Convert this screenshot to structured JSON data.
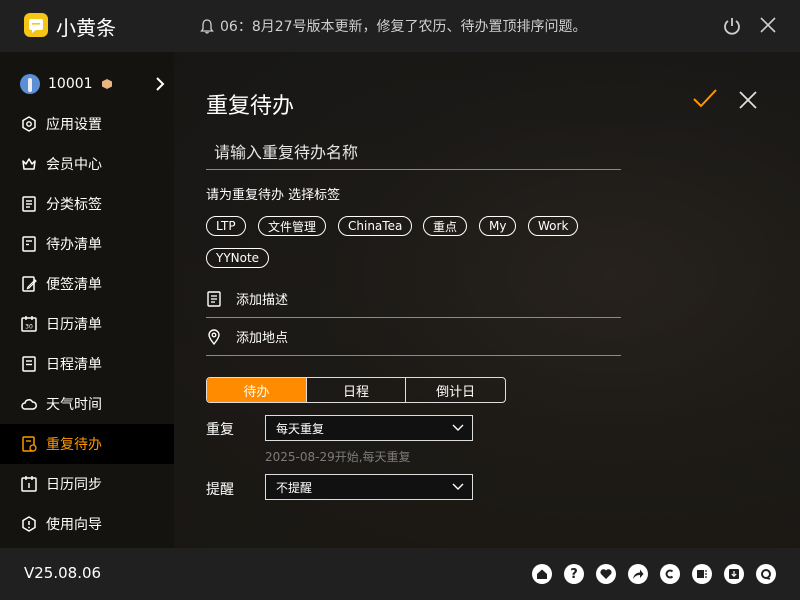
{
  "app": {
    "name": "小黄条"
  },
  "notice": {
    "text": "06：8月27号版本更新，修复了农历、待办置顶排序问题。"
  },
  "user": {
    "name": "10001"
  },
  "sidebar": {
    "items": [
      {
        "label": "应用设置"
      },
      {
        "label": "会员中心"
      },
      {
        "label": "分类标签"
      },
      {
        "label": "待办清单"
      },
      {
        "label": "便签清单"
      },
      {
        "label": "日历清单"
      },
      {
        "label": "日程清单"
      },
      {
        "label": "天气时间"
      },
      {
        "label": "重复待办"
      },
      {
        "label": "日历同步"
      },
      {
        "label": "使用向导"
      }
    ]
  },
  "main": {
    "title": "重复待办",
    "name_placeholder": "请输入重复待办名称",
    "tag_hint": "请为重复待办 选择标签",
    "tags": [
      "LTP",
      "文件管理",
      "ChinaTea",
      "重点",
      "My",
      "Work",
      "YYNote"
    ],
    "add_description": "添加描述",
    "add_location": "添加地点",
    "segments": [
      "待办",
      "日程",
      "倒计日"
    ],
    "repeat_label": "重复",
    "repeat_value": "每天重复",
    "repeat_hint": "2025-08-29开始,每天重复",
    "remind_label": "提醒",
    "remind_value": "不提醒"
  },
  "footer": {
    "version": "V25.08.06"
  },
  "colors": {
    "accent": "#ff8c00",
    "brand": "#f5c518"
  }
}
